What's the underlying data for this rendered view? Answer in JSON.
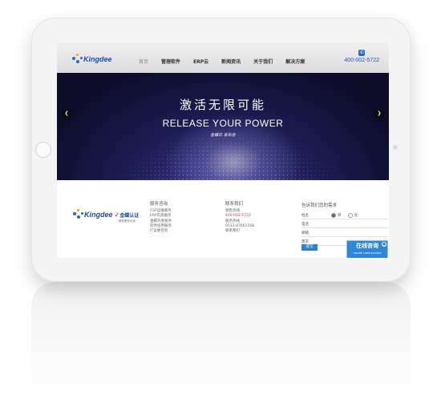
{
  "header": {
    "logo_text": "Kingdee",
    "nav": [
      "首页",
      "管理软件",
      "ERP云",
      "新闻资讯",
      "关于我们",
      "解决方案"
    ],
    "phone": "400-002-5722"
  },
  "banner": {
    "headline_cn": "激活无限可能",
    "headline_en": "RELEASE YOUR POWER",
    "launch_text": "金蝶云 发布会"
  },
  "footer": {
    "logo_text": "Kingdee",
    "cert_text": "金蝶认证",
    "cert_subtext": "授权服务伙伴",
    "services": {
      "title": "服务咨询",
      "items": [
        "CSP运维服务",
        "ERP实施服务",
        "金蝶开发服务",
        "软件续用服务",
        "IT运维咨询"
      ]
    },
    "contact": {
      "title": "联系我们",
      "sales_label": "销售热线",
      "sales_phone": "400-002-5722",
      "service_label": "服务热线",
      "service_phone": "0512-87661168",
      "link": "联系我们"
    },
    "form": {
      "title": "告诉我们您的需求",
      "name_label": "姓名",
      "gender_male": "男",
      "gender_female": "女",
      "phone_label": "电话",
      "email_label": "邮箱",
      "need_label": "需求",
      "submit_label": "提交"
    }
  },
  "chat_widget": {
    "label": "在线咨询",
    "sublabel": "ONLINE CONSULTATION"
  },
  "colors": {
    "brand_blue": "#1c4ea8",
    "banner_dark": "#14143a",
    "chat_blue": "#2e86d6"
  }
}
